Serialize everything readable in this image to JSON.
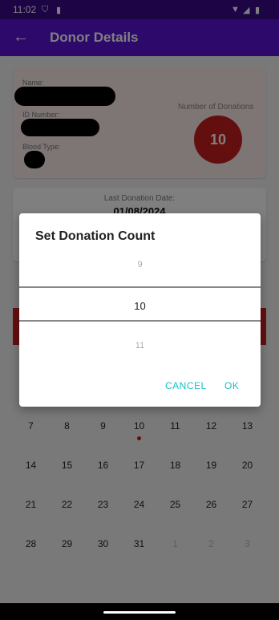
{
  "status_bar": {
    "time": "11:02"
  },
  "app_bar": {
    "title": "Donor Details",
    "back_icon": "arrow-left-icon"
  },
  "donor_card": {
    "name_label": "Name:",
    "id_label": "ID Number:",
    "blood_label": "Blood Type:",
    "donations_label": "Number of Donations",
    "donations_count": "10"
  },
  "last_donation": {
    "label": "Last Donation Date:",
    "date": "01/08/2024"
  },
  "calendar": {
    "rows": [
      [
        "7",
        "8",
        "9",
        "10",
        "11",
        "12",
        "13"
      ],
      [
        "14",
        "15",
        "16",
        "17",
        "18",
        "19",
        "20"
      ],
      [
        "21",
        "22",
        "23",
        "24",
        "25",
        "26",
        "27"
      ],
      [
        "28",
        "29",
        "30",
        "31",
        "1",
        "2",
        "3"
      ]
    ],
    "marked_day": "10"
  },
  "dialog": {
    "title": "Set Donation Count",
    "picker_prev": "9",
    "picker_selected": "10",
    "picker_next": "11",
    "cancel_label": "CANCEL",
    "ok_label": "OK"
  },
  "colors": {
    "primary": "#5a12d6",
    "status_bar": "#3b0a8a",
    "accent": "#18c0c8",
    "donation_red": "#c81e1e"
  }
}
